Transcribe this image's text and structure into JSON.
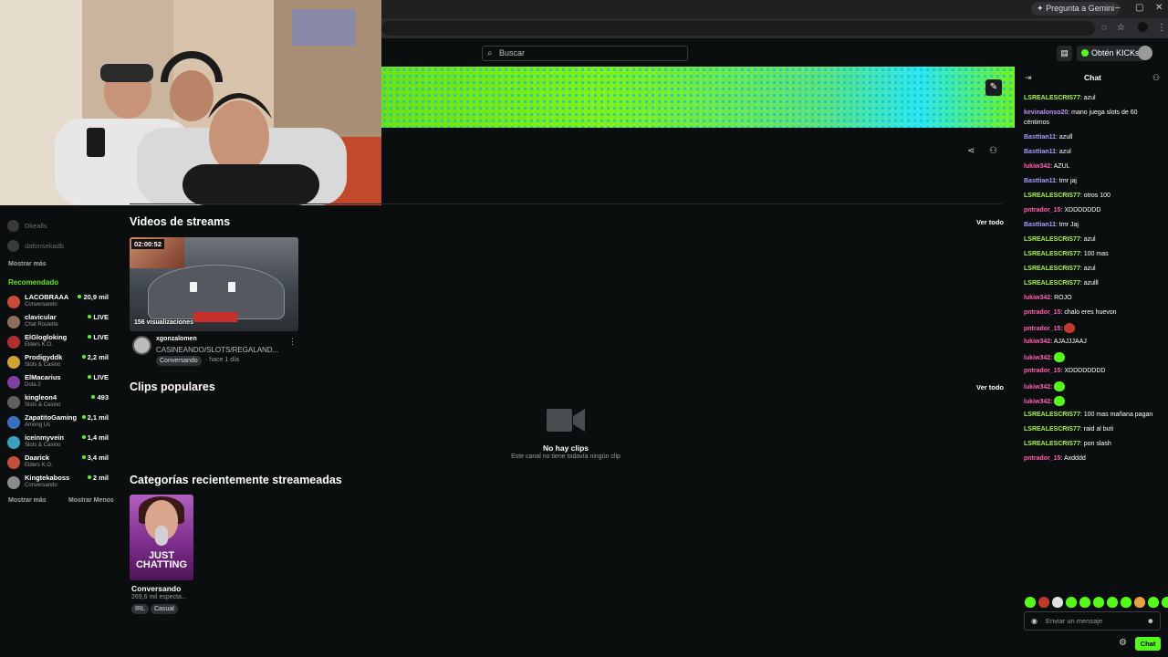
{
  "browser": {
    "gemini_label": "Pregunta a Gemini",
    "win_min": "–",
    "win_max": "▢",
    "win_close": "✕"
  },
  "header": {
    "search_placeholder": "Buscar",
    "kicks_label": "Obtén KICKs"
  },
  "sidebar": {
    "faded_items": [
      "Dkealls",
      "dafonsekadb"
    ],
    "show_more_following": "Mostrar más",
    "recommended_heading": "Recomendado",
    "recommended": [
      {
        "name": "LACOBRAAA",
        "category": "Conversando",
        "count": "20,9 mil",
        "color": "#c94a3b"
      },
      {
        "name": "clavicular",
        "category": "Chat Roulette",
        "count": "LIVE",
        "color": "#8b6f5a"
      },
      {
        "name": "ElGlogloking",
        "category": "Elders K.O.",
        "count": "LIVE",
        "color": "#b03030"
      },
      {
        "name": "Prodigyddk",
        "category": "Slots & Casino",
        "count": "2,2 mil",
        "color": "#d0a030"
      },
      {
        "name": "ElMacarius",
        "category": "Dota 2",
        "count": "LIVE",
        "color": "#7a3fa0"
      },
      {
        "name": "kingleon4",
        "category": "Slots & Casino",
        "count": "493",
        "color": "#606060"
      },
      {
        "name": "ZapatitoGaming",
        "category": "Among Us",
        "count": "2,1 mil",
        "color": "#3a6fc0"
      },
      {
        "name": "iceinmyvein",
        "category": "Slots & Casino",
        "count": "1,4 mil",
        "color": "#3aa0c0"
      },
      {
        "name": "Daarick",
        "category": "Elders K.O.",
        "count": "3,4 mil",
        "color": "#c0503a"
      },
      {
        "name": "Kingtekaboss",
        "category": "Conversando",
        "count": "2 mil",
        "color": "#8a8a8a"
      }
    ],
    "show_more": "Mostrar más",
    "show_less": "Mostrar Menos"
  },
  "main": {
    "videos_title": "Videos de streams",
    "clips_title": "Clips populares",
    "categories_title": "Categorías recientemente streameadas",
    "see_all": "Ver todo",
    "video": {
      "duration": "02:00:52",
      "views": "156 visualizaciones",
      "channel": "xgonzalomen",
      "title": "CASINEANDO/SLOTS/REGALAND...",
      "tag": "Conversando",
      "time": "· hace 1 día"
    },
    "no_clips": "No hay clips",
    "no_clips_sub": "Este canal no tiene todavía ningún clip",
    "category": {
      "card_text": "JUST CHATTING",
      "name": "Conversando",
      "viewers": "269,6 mil especta...",
      "tags": [
        "IRL",
        "Casual"
      ]
    }
  },
  "chat": {
    "title": "Chat",
    "input_placeholder": "Enviar un mensaje",
    "send_label": "Chat",
    "messages": [
      {
        "user": "LSREALESCRIS77",
        "text": "azul",
        "color": "#a4f542"
      },
      {
        "user": "kevinalonso20",
        "text": "mano juega slots de 60 céntimos",
        "color": "#c78cff"
      },
      {
        "user": "Basttian11",
        "text": "azull",
        "color": "#a99bff"
      },
      {
        "user": "Basttian11",
        "text": "azul",
        "color": "#a99bff"
      },
      {
        "user": "lukiw342",
        "text": "AZUL",
        "color": "#ff5fae"
      },
      {
        "user": "Basttian11",
        "text": "tmr jaj",
        "color": "#a99bff"
      },
      {
        "user": "LSREALESCRIS77",
        "text": "otros 100",
        "color": "#a4f542"
      },
      {
        "user": "pntrador_15",
        "text": "XDDDDDDD",
        "color": "#ff5fae"
      },
      {
        "user": "Basttian11",
        "text": "tmr Jaj",
        "color": "#a99bff"
      },
      {
        "user": "LSREALESCRIS77",
        "text": "azul",
        "color": "#a4f542"
      },
      {
        "user": "LSREALESCRIS77",
        "text": "100 mas",
        "color": "#a4f542"
      },
      {
        "user": "LSREALESCRIS77",
        "text": "azul",
        "color": "#a4f542"
      },
      {
        "user": "LSREALESCRIS77",
        "text": "azulll",
        "color": "#a4f542"
      },
      {
        "user": "lukiw342",
        "text": "ROJO",
        "color": "#ff5fae"
      },
      {
        "user": "pntrador_15",
        "text": "chalo eres huevon",
        "color": "#ff5fae"
      },
      {
        "user": "pntrador_15",
        "text": "",
        "color": "#ff5fae",
        "emote": "#c0392b"
      },
      {
        "user": "lukiw342",
        "text": "AJAJJJAAJ",
        "color": "#ff5fae"
      },
      {
        "user": "lukiw342",
        "text": "",
        "color": "#ff5fae",
        "emote": "#53fc18"
      },
      {
        "user": "pntrador_15",
        "text": "XDDDDDDDD",
        "color": "#ff5fae"
      },
      {
        "user": "lukiw342",
        "text": "",
        "color": "#ff5fae",
        "emote": "#53fc18"
      },
      {
        "user": "lukiw342",
        "text": "",
        "color": "#ff5fae",
        "emote": "#53fc18"
      },
      {
        "user": "LSREALESCRIS77",
        "text": "100 mas mañana pagan",
        "color": "#a4f542"
      },
      {
        "user": "LSREALESCRIS77",
        "text": "raid al buti",
        "color": "#a4f542"
      },
      {
        "user": "LSREALESCRIS77",
        "text": "pon slash",
        "color": "#a4f542"
      },
      {
        "user": "pntrador_15",
        "text": "Axdddd",
        "color": "#ff5fae"
      }
    ],
    "emote_bar": [
      "#53fc18",
      "#c0392b",
      "#e0e0e0",
      "#53fc18",
      "#53fc18",
      "#53fc18",
      "#53fc18",
      "#53fc18",
      "#e8a040",
      "#53fc18",
      "#53fc18"
    ]
  },
  "colors": {
    "accent": "#53fc18",
    "background": "#0b0e0f"
  }
}
